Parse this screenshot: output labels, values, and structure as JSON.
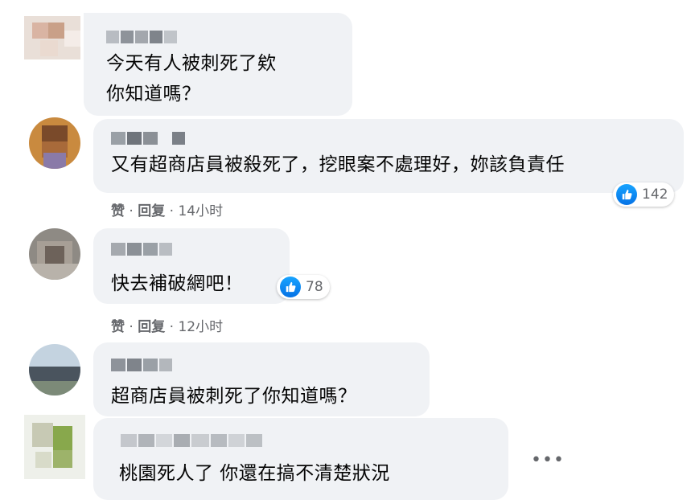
{
  "comments": [
    {
      "text_lines": [
        "今天有人被刺死了欸",
        "你知道嗎？"
      ]
    },
    {
      "text_lines": [
        "又有超商店員被殺死了，挖眼案不處理好，妳該負責任"
      ],
      "like": "赞",
      "reply": "回复",
      "time": "14小时",
      "reactions": "142"
    },
    {
      "text_lines": [
        "快去補破網吧！"
      ],
      "like": "赞",
      "reply": "回复",
      "time": "12小时",
      "reactions": "78"
    },
    {
      "text_lines": [
        "超商店員被刺死了你知道嗎？"
      ]
    },
    {
      "text_lines": [
        "桃園死人了 你還在搞不清楚狀況"
      ]
    }
  ],
  "more_options": "•••",
  "separator": "·",
  "colors": {
    "bubble": "#f0f2f5",
    "like_blue": "#1877f2",
    "meta_gray": "#65676b"
  }
}
